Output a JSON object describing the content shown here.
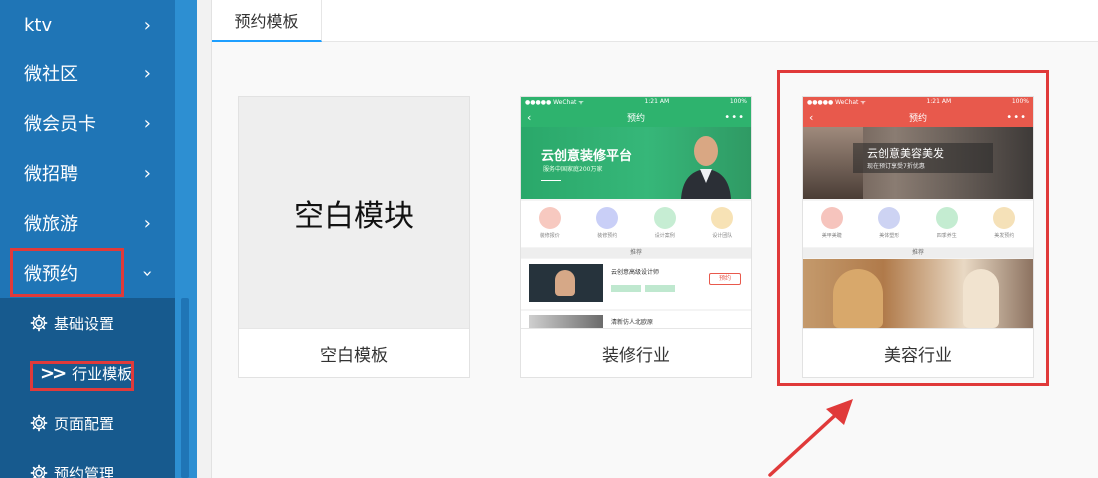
{
  "sidebar": {
    "items": [
      {
        "label": "ktv"
      },
      {
        "label": "微社区"
      },
      {
        "label": "微会员卡"
      },
      {
        "label": "微招聘"
      },
      {
        "label": "微旅游"
      },
      {
        "label": "微预约"
      }
    ],
    "submenu": [
      {
        "label": "基础设置"
      },
      {
        "label": "行业模板"
      },
      {
        "label": "页面配置"
      },
      {
        "label": "预约管理"
      }
    ]
  },
  "tabs": [
    {
      "label": "预约模板"
    }
  ],
  "templates": [
    {
      "thumb_text": "空白模块",
      "caption": "空白模板"
    },
    {
      "caption": "装修行业",
      "phone": {
        "status_left": "●●●●● WeChat ᯤ",
        "status_time": "1:21 AM",
        "status_right": "100%",
        "nav_title": "预约",
        "banner_title": "云创意装修平台",
        "banner_sub": "服务中国家庭200万家",
        "icons": [
          "装修报价",
          "装修预约",
          "设计案例",
          "设计团队"
        ],
        "section": "推荐",
        "row1_title": "云创意高级设计师",
        "row1_btn": "预约",
        "row2_title": "清新仿人北欧原"
      }
    },
    {
      "caption": "美容行业",
      "phone": {
        "status_left": "●●●●● WeChat ᯤ",
        "status_time": "1:21 AM",
        "status_right": "100%",
        "nav_title": "预约",
        "banner_title": "云创意美容美发",
        "banner_sub": "现在预订享受7折优惠",
        "icons": [
          "美甲美睫",
          "美体塑形",
          "四季养生",
          "美发预约"
        ],
        "section": "推荐"
      }
    }
  ],
  "colors": {
    "sidebar": "#1f75b6",
    "submenu": "#175a8e",
    "accent": "#1e9fff",
    "highlight": "#e03a3a",
    "decor_green": "#2eb36e",
    "beauty_red": "#e8594c"
  }
}
